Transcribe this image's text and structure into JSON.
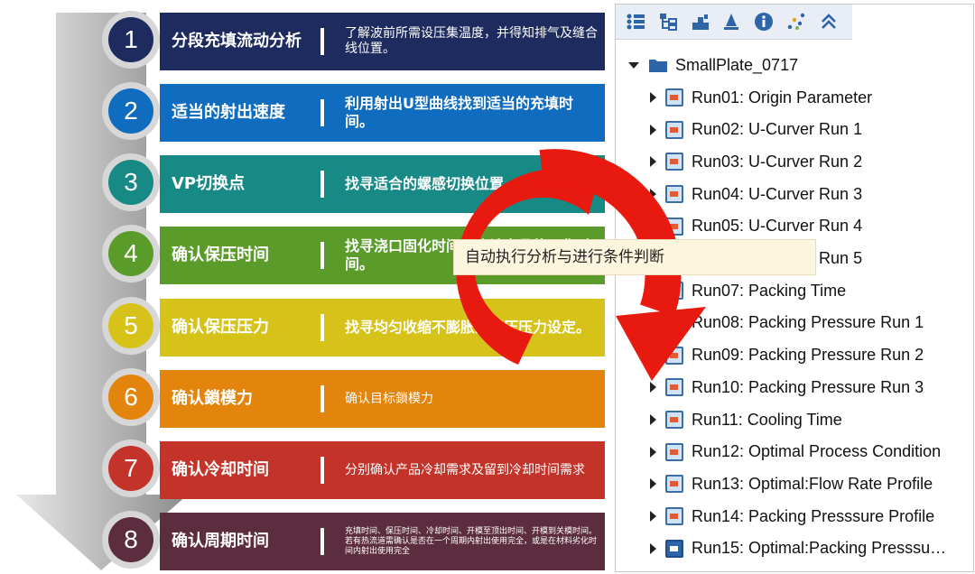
{
  "steps": [
    {
      "num": "1",
      "title": "分段充填流动分析",
      "desc": "了解波前所需设压集温度，并得知排气及缝合线位置。",
      "band_color": "#1d2b5e",
      "circle_color": "#1d2b5e",
      "desc_style": "normal"
    },
    {
      "num": "2",
      "title": "适当的射出速度",
      "desc": "利用射出U型曲线找到适当的充填时间。",
      "band_color": "#0f6cbf",
      "circle_color": "#0f6cbf",
      "desc_style": "bold"
    },
    {
      "num": "3",
      "title": "VP切换点",
      "desc": "找寻适合的螺感切换位置。",
      "band_color": "#178a86",
      "circle_color": "#178a86",
      "desc_style": "bold"
    },
    {
      "num": "4",
      "title": "确认保压时间",
      "desc": "找寻浇口固化时间与确认产品的固化时间。",
      "band_color": "#5a9b2a",
      "circle_color": "#5a9b2a",
      "desc_style": "bold"
    },
    {
      "num": "5",
      "title": "确认保压压力",
      "desc": "找寻均匀收缩不膨胀的保压压力设定。",
      "band_color": "#d7c21a",
      "circle_color": "#d7c21a",
      "desc_style": "bold"
    },
    {
      "num": "6",
      "title": "确认鎖模力",
      "desc": "确认目标鎖模力",
      "band_color": "#e3850c",
      "circle_color": "#e3850c",
      "desc_style": "normal"
    },
    {
      "num": "7",
      "title": "确认冷却时间",
      "desc": "分别确认产品冷却需求及留到冷却时间需求",
      "band_color": "#c43329",
      "circle_color": "#c43329",
      "desc_style": "normal"
    },
    {
      "num": "8",
      "title": "确认周期时间",
      "desc": "充填时间、保压时间、冷却时间、开模至顶出时间、开模到关模时间。若有热流道需确认是否在一个周期内射出使用完全，或是在材料劣化时间内射出使用完全",
      "band_color": "#5c2d3f",
      "circle_color": "#5c2d3f",
      "desc_style": "tiny"
    }
  ],
  "toolbar": {
    "icons": [
      "list-icon",
      "tree-structure-icon",
      "mold-icon",
      "injection-icon",
      "info-icon",
      "scatter-icon",
      "collapse-up-icon"
    ]
  },
  "tree": {
    "root": "SmallPlate_0717",
    "runs": [
      "Run01: Origin Parameter",
      "Run02: U-Curver Run 1",
      "Run03: U-Curver Run 2",
      "Run04: U-Curver Run 3",
      "Run05: U-Curver Run 4",
      "Run06: U-Curver Run 5",
      "Run07: Packing Time",
      "Run08: Packing Pressure Run 1",
      "Run09: Packing Pressure Run 2",
      "Run10: Packing Pressure Run 3",
      "Run11: Cooling Time",
      "Run12: Optimal Process Condition",
      "Run13: Optimal:Flow Rate Profile",
      "Run14: Packing Presssure Profile",
      "Run15:  Optimal:Packing  Presssu…"
    ]
  },
  "tooltip": "自动执行分析与进行条件判断",
  "colors": {
    "accent_red": "#e8190f",
    "panel_toolbar": "#e9eef6",
    "icon_blue": "#2e64a8"
  }
}
